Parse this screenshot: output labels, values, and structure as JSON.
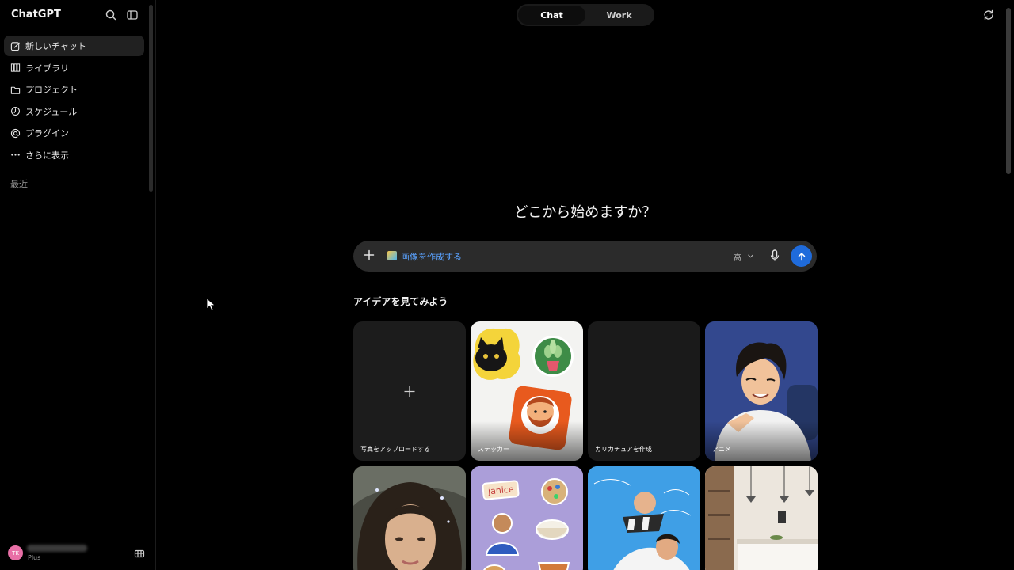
{
  "app": {
    "title": "ChatGPT"
  },
  "sidebar": {
    "items": [
      {
        "label": "新しいチャット",
        "icon": "new-chat-icon"
      },
      {
        "label": "ライブラリ",
        "icon": "library-icon"
      },
      {
        "label": "プロジェクト",
        "icon": "folder-icon"
      },
      {
        "label": "スケジュール",
        "icon": "clock-icon"
      },
      {
        "label": "プラグイン",
        "icon": "at-icon"
      },
      {
        "label": "さらに表示",
        "icon": "more-icon"
      }
    ],
    "section_recent": "最近",
    "user": {
      "initials": "TK",
      "plan": "Plus"
    }
  },
  "header": {
    "modes": [
      "Chat",
      "Work"
    ],
    "active_mode": "Chat"
  },
  "main": {
    "headline": "どこから始めますか？",
    "composer": {
      "tool_label": "画像を作成する",
      "quality": "高"
    },
    "ideas_title": "アイデアを見てみよう",
    "cards": [
      {
        "label": "写真をアップロードする"
      },
      {
        "label": "ステッカー"
      },
      {
        "label": "カリカチュアを作成"
      },
      {
        "label": "アニメ"
      },
      {
        "label": ""
      },
      {
        "label": ""
      },
      {
        "label": ""
      },
      {
        "label": ""
      }
    ],
    "sticker_text": "janice"
  },
  "colors": {
    "accent": "#1f6bdb",
    "tool_text": "#5aa2ff",
    "avatar": "#e86fa6"
  }
}
